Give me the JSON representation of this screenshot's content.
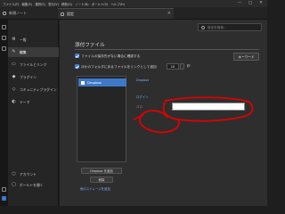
{
  "menubar": {
    "items": [
      "ファイル(F)",
      "編集(E)",
      "選択(S)",
      "表示(V)",
      "移動(G)",
      "ノート(N)",
      "ボールト(V)",
      "ヘルプ(H)"
    ],
    "window_controls": [
      "—",
      "□",
      "✕"
    ]
  },
  "tabs": [
    {
      "label": "新規ノート"
    },
    {
      "label": "設定"
    }
  ],
  "sidebar": {
    "items": [
      {
        "label": "一般",
        "icon": "gear-icon"
      },
      {
        "label": "編集",
        "icon": "pencil-icon"
      },
      {
        "label": "ファイルとリンク",
        "icon": "folder-icon"
      },
      {
        "label": "プラグイン",
        "icon": "puzzle-icon"
      },
      {
        "label": "コミュニティプラグイン",
        "icon": "plugin-icon"
      },
      {
        "label": "テーマ",
        "icon": "palette-icon"
      }
    ],
    "bottom_items": [
      {
        "label": "アカウント",
        "icon": "account-icon"
      },
      {
        "label": "ボールトを開く",
        "icon": "vault-icon"
      }
    ]
  },
  "search": {
    "placeholder": "設定を検索..."
  },
  "main": {
    "section_title": "添付ファイル",
    "options": [
      {
        "label": "ファイルの保存先がない場合に確認する",
        "checked": true
      },
      {
        "label": "ほかのフォルダにあるファイルをリンクとして追加",
        "checked": true
      }
    ],
    "interval_value": "10",
    "interval_unit": "秒",
    "shortcut_button": "キーワード",
    "storage_list": [
      {
        "label": "Dropbox",
        "icon": "dropbox-icon",
        "selected": true
      }
    ],
    "add_button": "Dropbox を追加",
    "remove_button": "削除",
    "more_link": "他のストレージを追加",
    "detail_link_1": "Dropbox",
    "detail_link_2": "ログイン",
    "detail_label": "パス:",
    "path_value": ""
  },
  "colors": {
    "accent": "#3e78c8",
    "annotation": "#e00000",
    "background": "#2e2e2e"
  }
}
